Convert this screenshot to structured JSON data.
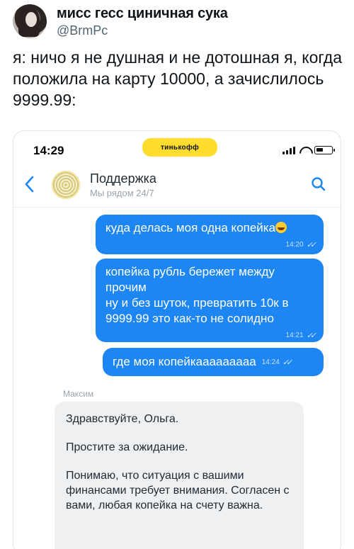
{
  "tweet": {
    "display_name": "мисс гесс циничная сука",
    "handle": "@BrmPc",
    "text": "я: ничо я не душная и не дотошная я, когда положила на карту 10000, а зачислилось 9999.99:"
  },
  "phone": {
    "status_time": "14:29",
    "bank_logo_text": "тинькофф",
    "accent_color": "#ffdd2d",
    "chat_title": "Поддержка",
    "chat_subtitle": "Мы рядом 24/7",
    "icons": {
      "back": "chevron-left-icon",
      "search": "search-icon"
    },
    "messages_out": [
      {
        "text": "куда делась моя одна копейка",
        "time": "14:20"
      },
      {
        "text": "копейка рубль бережет между прочим\nну и без шуток, превратить 10к в 9999.99 это как-то не солидно",
        "time": "14:21"
      },
      {
        "text": "где моя копейкааааааааа",
        "time": "14:24"
      }
    ],
    "agent_name": "Максим",
    "agent_message": {
      "p1": "Здравствуйте, Ольга.",
      "p2": "Простите за ожидание.",
      "p3": "Понимаю, что ситуация с вашими финансами требует внимания. Согласен с вами, любая копейка на счету важна."
    },
    "bubble_color": "#1d86f2"
  }
}
